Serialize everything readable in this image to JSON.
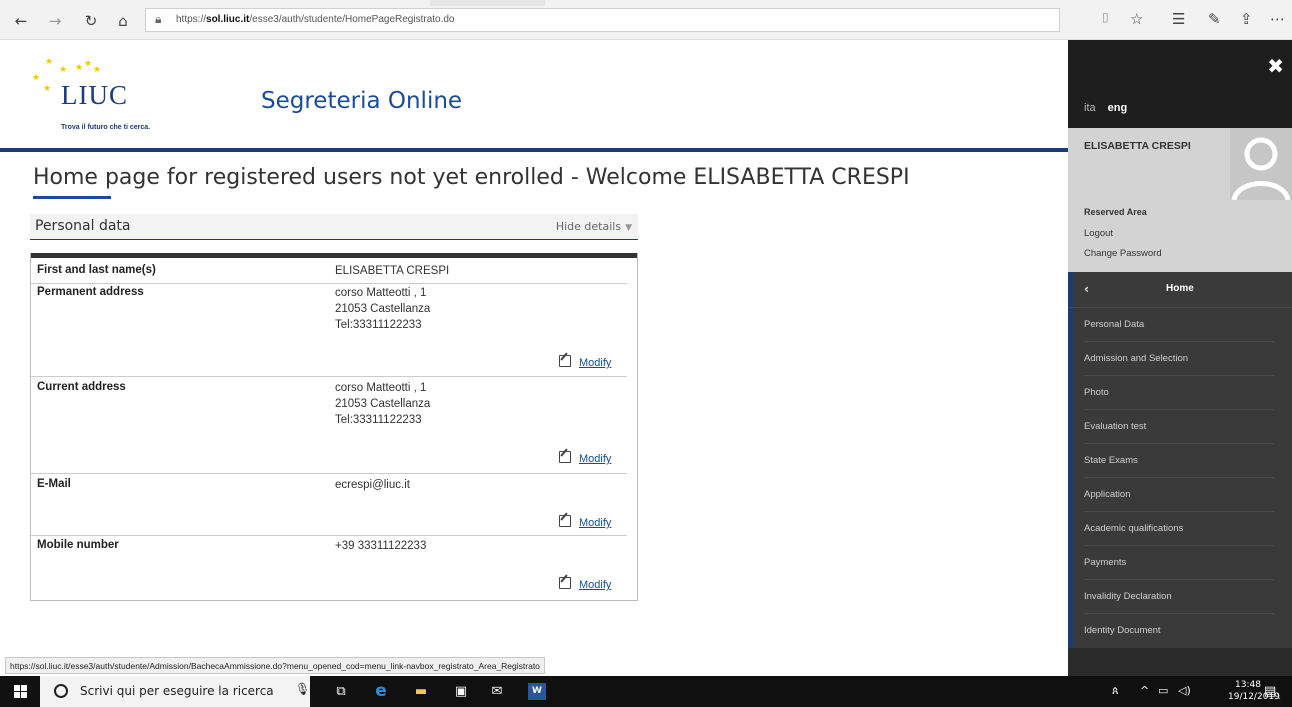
{
  "browser": {
    "url_prefix": "https://",
    "url_host": "sol.liuc.it",
    "url_path": "/esse3/auth/studente/HomePageRegistrato.do",
    "back_icon": "arrow-left-icon",
    "forward_icon": "arrow-right-icon",
    "refresh_icon": "refresh-icon",
    "home_icon": "home-icon",
    "lock_icon": "lock-icon"
  },
  "header": {
    "logo_text": "LIUC",
    "logo_tagline": "Trova il futuro che ti cerca.",
    "site_title": "Segreteria Online",
    "accent_color": "#1a3c78"
  },
  "main": {
    "page_title": "Home page for registered users not yet enrolled - Welcome  ELISABETTA CRESPI",
    "panel_title": "Personal data",
    "panel_toggle": "Hide details",
    "rows": [
      {
        "label": "First and last name(s)",
        "lines": [
          "ELISABETTA CRESPI"
        ],
        "modify": ""
      },
      {
        "label": "Permanent address",
        "lines": [
          "corso Matteotti , 1",
          "21053 Castellanza",
          "Tel:33311122233"
        ],
        "modify": "Modify"
      },
      {
        "label": "Current address",
        "lines": [
          "corso Matteotti , 1",
          "21053 Castellanza",
          "Tel:33311122233"
        ],
        "modify": "Modify"
      },
      {
        "label": "E-Mail",
        "lines": [
          "ecrespi@liuc.it"
        ],
        "modify": "Modify"
      },
      {
        "label": "Mobile number",
        "lines": [
          "+39 33311122233"
        ],
        "modify": "Modify"
      }
    ]
  },
  "sidebar": {
    "lang_ita": "ita",
    "lang_eng": "eng",
    "user_name": "ELISABETTA CRESPI",
    "reserved_area": "Reserved Area",
    "logout": "Logout",
    "change_password": "Change Password",
    "home_label": "Home",
    "items": [
      "Personal Data",
      "Admission and Selection",
      "Photo",
      "Evaluation test",
      "State Exams",
      "Application",
      "Academic qualifications",
      "Payments",
      "Invalidity Declaration",
      "Identity Document"
    ]
  },
  "status_bar": {
    "link_url": "https://sol.liuc.it/esse3/auth/studente/Admission/BachecaAmmissione.do?menu_opened_cod=menu_link-navbox_registrato_Area_Registrato"
  },
  "taskbar": {
    "search_placeholder": "Scrivi qui per eseguire la ricerca",
    "time": "13:48",
    "date": "19/12/2019",
    "notification_count": "1"
  }
}
